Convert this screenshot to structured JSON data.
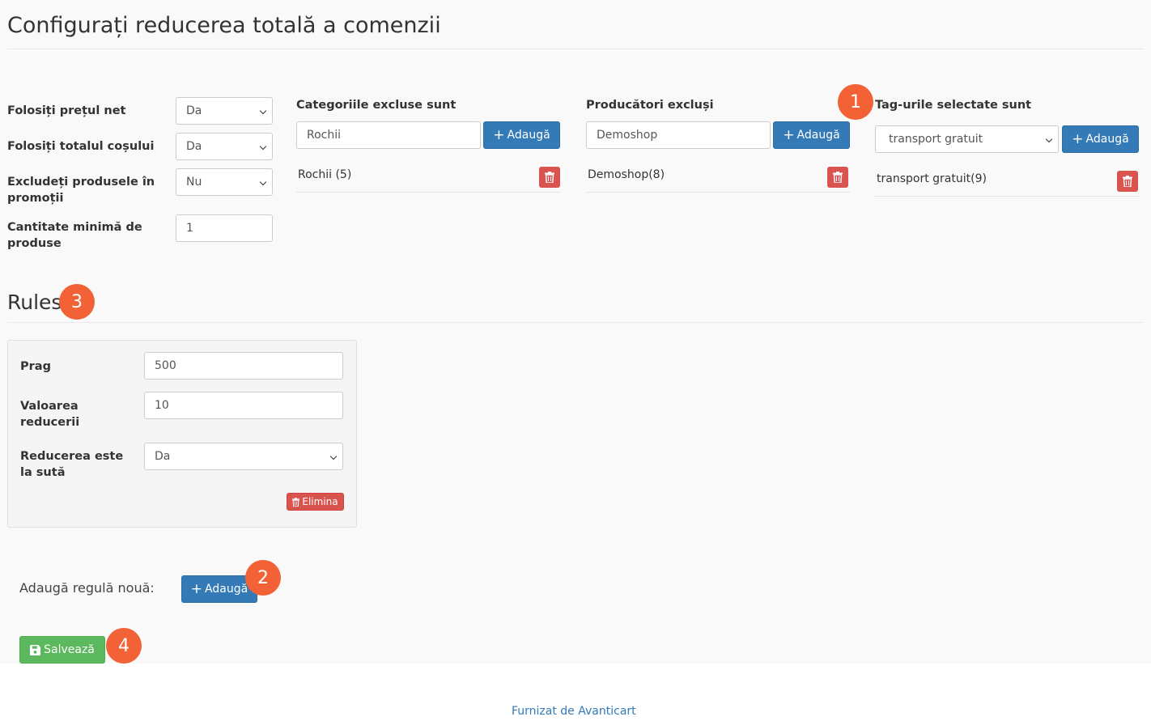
{
  "page": {
    "title": "Configurați reducerea totală a comenzii"
  },
  "settings": {
    "use_net_price": {
      "label": "Folosiți prețul net",
      "value": "Da"
    },
    "use_cart_total": {
      "label": "Folosiți totalul coșului",
      "value": "Da"
    },
    "exclude_promo": {
      "label": "Excludeți produsele în promoții",
      "value": "Nu"
    },
    "min_qty": {
      "label": "Cantitate minimă de produse",
      "value": "1"
    }
  },
  "categories": {
    "heading": "Categoriile excluse sunt",
    "input_value": "Rochii",
    "add_label": "Adaugă",
    "items": [
      {
        "label": "Rochii (5)"
      }
    ]
  },
  "manufacturers": {
    "heading": "Producători excluși",
    "input_value": "Demoshop",
    "add_label": "Adaugă",
    "items": [
      {
        "label": "Demoshop(8)"
      }
    ]
  },
  "tags": {
    "heading": "Tag-urile selectate sunt",
    "select_value": "transport gratuit",
    "add_label": "Adaugă",
    "items": [
      {
        "label": "transport gratuit(9)"
      }
    ]
  },
  "rules": {
    "heading": "Rules",
    "items": [
      {
        "threshold_label": "Prag",
        "threshold_value": "500",
        "discount_label": "Valoarea reducerii",
        "discount_value": "10",
        "percent_label": "Reducerea este la sută",
        "percent_value": "Da",
        "remove_label": "Elimina"
      }
    ],
    "new_rule_label": "Adaugă regulă nouă:",
    "new_rule_button": "Adaugă"
  },
  "save_label": "Salvează",
  "footer": {
    "text": "Furnizat de Avanticart"
  },
  "badges": [
    "1",
    "2",
    "3",
    "4"
  ],
  "colors": {
    "primary": "#337ab7",
    "danger": "#d9534f",
    "success": "#5cb85c",
    "badge": "#f26236"
  }
}
